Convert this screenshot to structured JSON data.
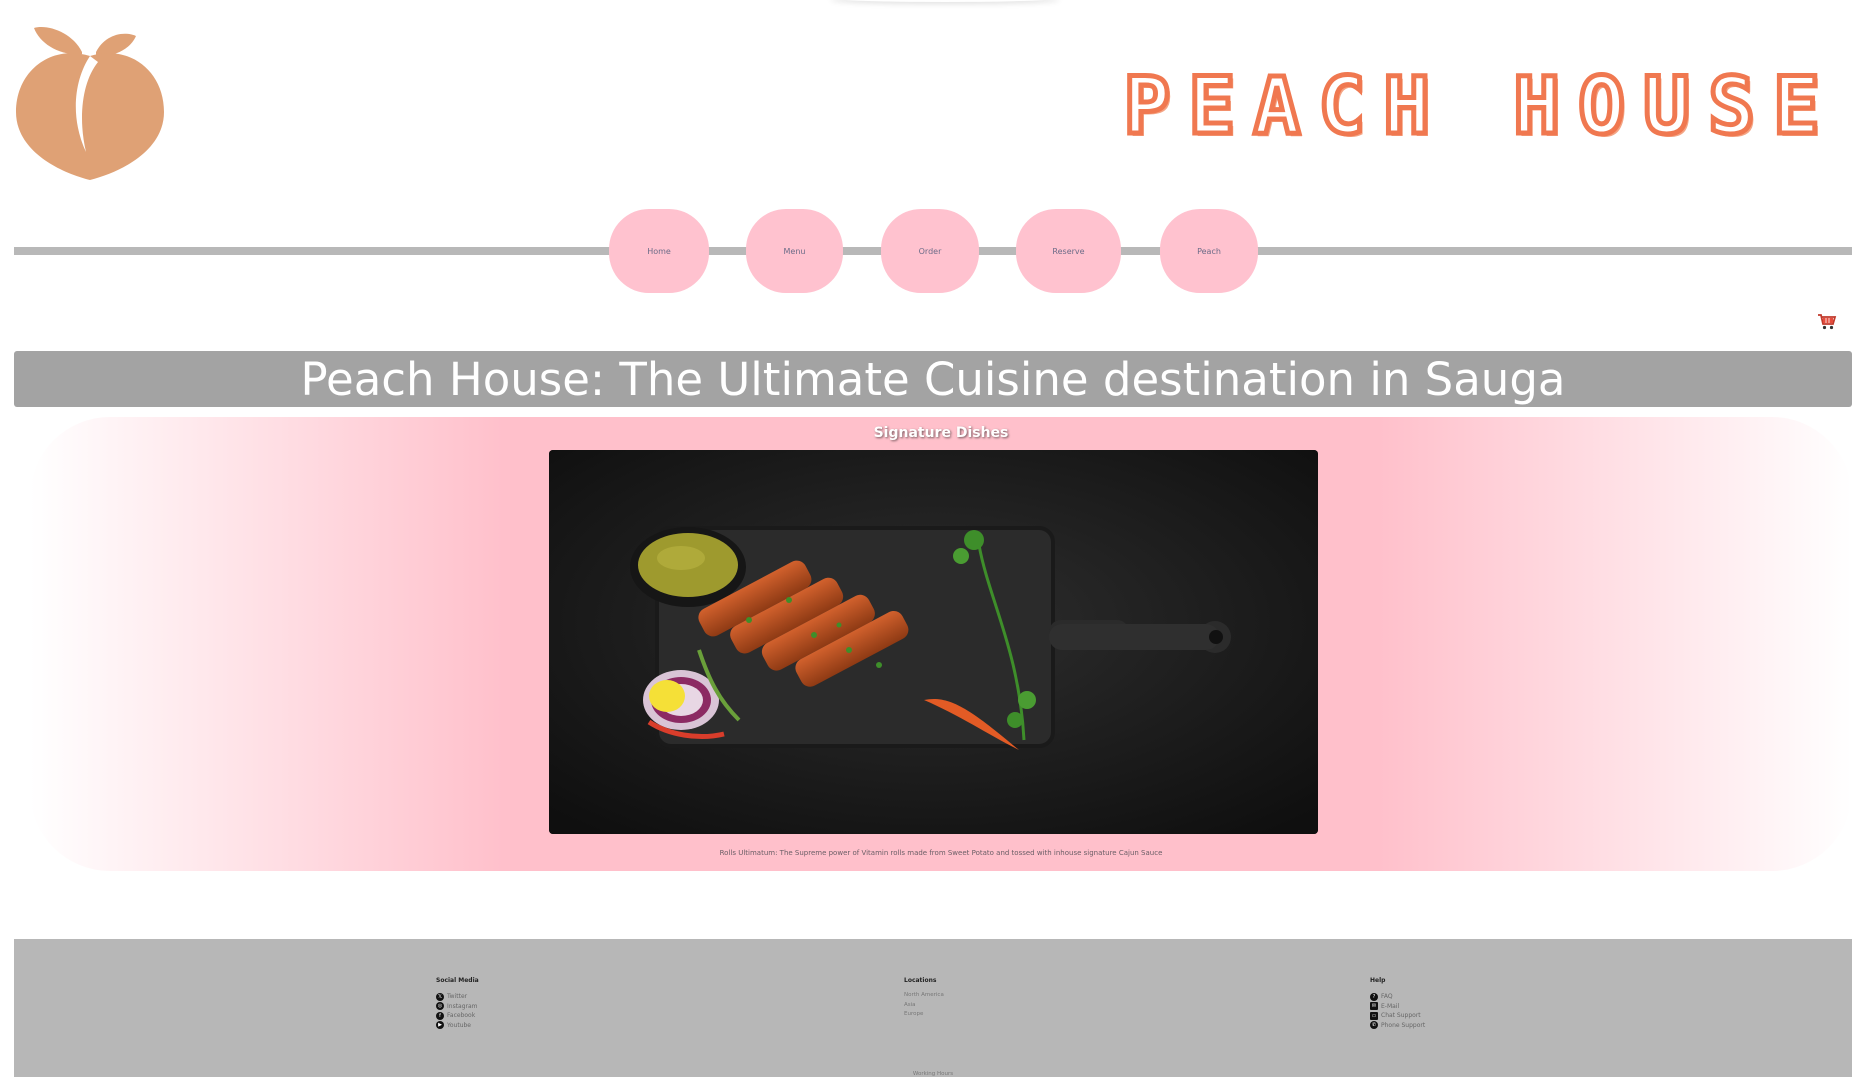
{
  "brand": {
    "name": "PEACH HOUSE",
    "logo_icon": "peach-icon",
    "logo_color": "#dfa175",
    "title_color": "#f07850"
  },
  "nav": {
    "items": [
      {
        "label": "Home"
      },
      {
        "label": "Menu"
      },
      {
        "label": "Order"
      },
      {
        "label": "Reserve"
      },
      {
        "label": "Peach"
      }
    ],
    "button_color": "#ffc2cf",
    "cart_icon": "shopping-cart-icon"
  },
  "hero": {
    "title": "Peach House: The Ultimate Cuisine destination in Sauga",
    "bar_color": "#a3a3a3"
  },
  "signature": {
    "heading": "Signature Dishes",
    "caption": "Rolls Ultimatum: The Supreme power of Vitamin rolls made from Sweet Potato and tossed with inhouse signature Cajun Sauce",
    "panel_color": "#ffc0cb"
  },
  "footer": {
    "social": {
      "heading": "Social Media",
      "items": [
        {
          "label": "Twitter",
          "icon": "twitter-icon"
        },
        {
          "label": "Instagram",
          "icon": "instagram-icon"
        },
        {
          "label": "Facebook",
          "icon": "facebook-icon"
        },
        {
          "label": "Youtube",
          "icon": "youtube-icon"
        }
      ]
    },
    "locations": {
      "heading": "Locations",
      "items": [
        {
          "label": "North America"
        },
        {
          "label": "Asia"
        },
        {
          "label": "Europe"
        }
      ]
    },
    "help": {
      "heading": "Help",
      "items": [
        {
          "label": "FAQ",
          "icon": "question-icon"
        },
        {
          "label": "E-Mail",
          "icon": "mail-icon"
        },
        {
          "label": "Chat Support",
          "icon": "chat-icon"
        },
        {
          "label": "Phone Support",
          "icon": "phone-icon"
        }
      ]
    },
    "working_hours": "Working Hours",
    "background": "#b7b7b7"
  }
}
